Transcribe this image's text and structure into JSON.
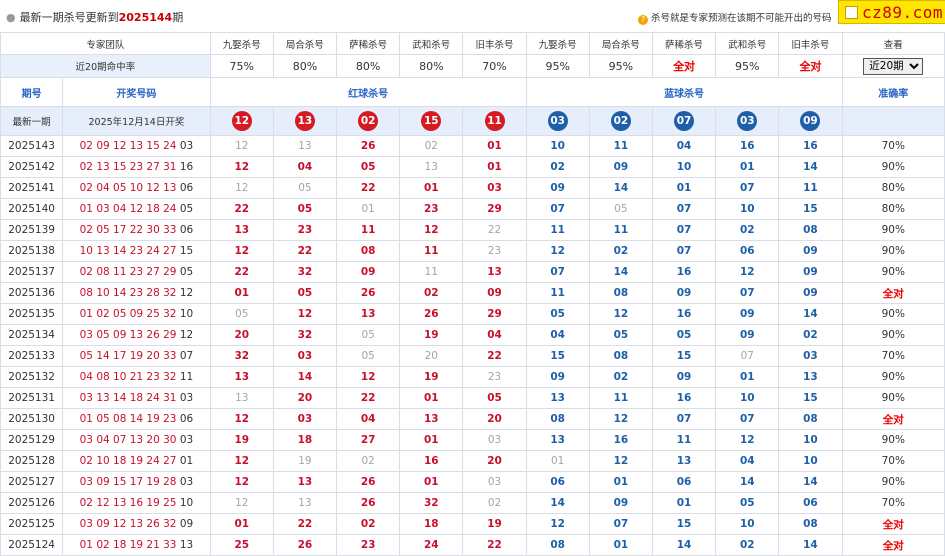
{
  "top": {
    "notice_prefix": "最新一期杀号更新到",
    "notice_period": "2025144",
    "notice_suffix": "期",
    "tip_icon": "?",
    "tip": "杀号就是专家预测在该期不可能开出的号码",
    "logo": "cz89.com"
  },
  "teams": [
    "专家团队",
    "九娶杀号",
    "局合杀号",
    "萨稀杀号",
    "武和杀号",
    "旧丰杀号",
    "九娶杀号",
    "局合杀号",
    "萨稀杀号",
    "武和杀号",
    "旧丰杀号",
    "查看"
  ],
  "rates_label": "近20期命中率",
  "rates": [
    "75%",
    "80%",
    "80%",
    "80%",
    "70%",
    "95%",
    "95%",
    "全对",
    "95%",
    "全对"
  ],
  "select": {
    "value": "近20期",
    "options": [
      "近20期"
    ]
  },
  "headers": {
    "period": "期号",
    "draw": "开奖号码",
    "red": "红球杀号",
    "blue": "蓝球杀号",
    "acc": "准确率"
  },
  "latest": {
    "label": "最新一期",
    "draw": "2025年12月14日开奖",
    "red": [
      "12",
      "13",
      "02",
      "15",
      "11"
    ],
    "blue": [
      "03",
      "02",
      "07",
      "03",
      "09"
    ]
  },
  "rows": [
    {
      "period": "2025143",
      "reds": "02 09 12 13 15 24",
      "blue": "03",
      "red": [
        [
          "12",
          0
        ],
        [
          "13",
          0
        ],
        [
          "26",
          1
        ],
        [
          "02",
          0
        ],
        [
          "01",
          1
        ]
      ],
      "bluek": [
        [
          "10",
          1
        ],
        [
          "11",
          1
        ],
        [
          "04",
          1
        ],
        [
          "16",
          1
        ],
        [
          "16",
          1
        ]
      ],
      "acc": "70%"
    },
    {
      "period": "2025142",
      "reds": "02 13 15 23 27 31",
      "blue": "16",
      "red": [
        [
          "12",
          1
        ],
        [
          "04",
          1
        ],
        [
          "05",
          1
        ],
        [
          "13",
          0
        ],
        [
          "01",
          1
        ]
      ],
      "bluek": [
        [
          "02",
          1
        ],
        [
          "09",
          1
        ],
        [
          "10",
          1
        ],
        [
          "01",
          1
        ],
        [
          "14",
          1
        ]
      ],
      "acc": "90%"
    },
    {
      "period": "2025141",
      "reds": "02 04 05 10 12 13",
      "blue": "06",
      "red": [
        [
          "12",
          0
        ],
        [
          "05",
          0
        ],
        [
          "22",
          1
        ],
        [
          "01",
          1
        ],
        [
          "03",
          1
        ]
      ],
      "bluek": [
        [
          "09",
          1
        ],
        [
          "14",
          1
        ],
        [
          "01",
          1
        ],
        [
          "07",
          1
        ],
        [
          "11",
          1
        ]
      ],
      "acc": "80%"
    },
    {
      "period": "2025140",
      "reds": "01 03 04 12 18 24",
      "blue": "05",
      "red": [
        [
          "22",
          1
        ],
        [
          "05",
          1
        ],
        [
          "01",
          0
        ],
        [
          "23",
          1
        ],
        [
          "29",
          1
        ]
      ],
      "bluek": [
        [
          "07",
          1
        ],
        [
          "05",
          0
        ],
        [
          "07",
          1
        ],
        [
          "10",
          1
        ],
        [
          "15",
          1
        ]
      ],
      "acc": "80%"
    },
    {
      "period": "2025139",
      "reds": "02 05 17 22 30 33",
      "blue": "06",
      "red": [
        [
          "13",
          1
        ],
        [
          "23",
          1
        ],
        [
          "11",
          1
        ],
        [
          "12",
          1
        ],
        [
          "22",
          0
        ]
      ],
      "bluek": [
        [
          "11",
          1
        ],
        [
          "11",
          1
        ],
        [
          "07",
          1
        ],
        [
          "02",
          1
        ],
        [
          "08",
          1
        ]
      ],
      "acc": "90%"
    },
    {
      "period": "2025138",
      "reds": "10 13 14 23 24 27",
      "blue": "15",
      "red": [
        [
          "12",
          1
        ],
        [
          "22",
          1
        ],
        [
          "08",
          1
        ],
        [
          "11",
          1
        ],
        [
          "23",
          0
        ]
      ],
      "bluek": [
        [
          "12",
          1
        ],
        [
          "02",
          1
        ],
        [
          "07",
          1
        ],
        [
          "06",
          1
        ],
        [
          "09",
          1
        ]
      ],
      "acc": "90%"
    },
    {
      "period": "2025137",
      "reds": "02 08 11 23 27 29",
      "blue": "05",
      "red": [
        [
          "22",
          1
        ],
        [
          "32",
          1
        ],
        [
          "09",
          1
        ],
        [
          "11",
          0
        ],
        [
          "13",
          1
        ]
      ],
      "bluek": [
        [
          "07",
          1
        ],
        [
          "14",
          1
        ],
        [
          "16",
          1
        ],
        [
          "12",
          1
        ],
        [
          "09",
          1
        ]
      ],
      "acc": "90%"
    },
    {
      "period": "2025136",
      "reds": "08 10 14 23 28 32",
      "blue": "12",
      "red": [
        [
          "01",
          1
        ],
        [
          "05",
          1
        ],
        [
          "26",
          1
        ],
        [
          "02",
          1
        ],
        [
          "09",
          1
        ]
      ],
      "bluek": [
        [
          "11",
          1
        ],
        [
          "08",
          1
        ],
        [
          "09",
          1
        ],
        [
          "07",
          1
        ],
        [
          "09",
          1
        ]
      ],
      "acc": "全对"
    },
    {
      "period": "2025135",
      "reds": "01 02 05 09 25 32",
      "blue": "10",
      "red": [
        [
          "05",
          0
        ],
        [
          "12",
          1
        ],
        [
          "13",
          1
        ],
        [
          "26",
          1
        ],
        [
          "29",
          1
        ]
      ],
      "bluek": [
        [
          "05",
          1
        ],
        [
          "12",
          1
        ],
        [
          "16",
          1
        ],
        [
          "09",
          1
        ],
        [
          "14",
          1
        ]
      ],
      "acc": "90%"
    },
    {
      "period": "2025134",
      "reds": "03 05 09 13 26 29",
      "blue": "12",
      "red": [
        [
          "20",
          1
        ],
        [
          "32",
          1
        ],
        [
          "05",
          0
        ],
        [
          "19",
          1
        ],
        [
          "04",
          1
        ]
      ],
      "bluek": [
        [
          "04",
          1
        ],
        [
          "05",
          1
        ],
        [
          "05",
          1
        ],
        [
          "09",
          1
        ],
        [
          "02",
          1
        ]
      ],
      "acc": "90%"
    },
    {
      "period": "2025133",
      "reds": "05 14 17 19 20 33",
      "blue": "07",
      "red": [
        [
          "32",
          1
        ],
        [
          "03",
          1
        ],
        [
          "05",
          0
        ],
        [
          "20",
          0
        ],
        [
          "22",
          1
        ]
      ],
      "bluek": [
        [
          "15",
          1
        ],
        [
          "08",
          1
        ],
        [
          "15",
          1
        ],
        [
          "07",
          0
        ],
        [
          "03",
          1
        ]
      ],
      "acc": "70%"
    },
    {
      "period": "2025132",
      "reds": "04 08 10 21 23 32",
      "blue": "11",
      "red": [
        [
          "13",
          1
        ],
        [
          "14",
          1
        ],
        [
          "12",
          1
        ],
        [
          "19",
          1
        ],
        [
          "23",
          0
        ]
      ],
      "bluek": [
        [
          "09",
          1
        ],
        [
          "02",
          1
        ],
        [
          "09",
          1
        ],
        [
          "01",
          1
        ],
        [
          "13",
          1
        ]
      ],
      "acc": "90%"
    },
    {
      "period": "2025131",
      "reds": "03 13 14 18 24 31",
      "blue": "03",
      "red": [
        [
          "13",
          0
        ],
        [
          "20",
          1
        ],
        [
          "22",
          1
        ],
        [
          "01",
          1
        ],
        [
          "05",
          1
        ]
      ],
      "bluek": [
        [
          "13",
          1
        ],
        [
          "11",
          1
        ],
        [
          "16",
          1
        ],
        [
          "10",
          1
        ],
        [
          "15",
          1
        ]
      ],
      "acc": "90%"
    },
    {
      "period": "2025130",
      "reds": "01 05 08 14 19 23",
      "blue": "06",
      "red": [
        [
          "12",
          1
        ],
        [
          "03",
          1
        ],
        [
          "04",
          1
        ],
        [
          "13",
          1
        ],
        [
          "20",
          1
        ]
      ],
      "bluek": [
        [
          "08",
          1
        ],
        [
          "12",
          1
        ],
        [
          "07",
          1
        ],
        [
          "07",
          1
        ],
        [
          "08",
          1
        ]
      ],
      "acc": "全对"
    },
    {
      "period": "2025129",
      "reds": "03 04 07 13 20 30",
      "blue": "03",
      "red": [
        [
          "19",
          1
        ],
        [
          "18",
          1
        ],
        [
          "27",
          1
        ],
        [
          "01",
          1
        ],
        [
          "03",
          0
        ]
      ],
      "bluek": [
        [
          "13",
          1
        ],
        [
          "16",
          1
        ],
        [
          "11",
          1
        ],
        [
          "12",
          1
        ],
        [
          "10",
          1
        ]
      ],
      "acc": "90%"
    },
    {
      "period": "2025128",
      "reds": "02 10 18 19 24 27",
      "blue": "01",
      "red": [
        [
          "12",
          1
        ],
        [
          "19",
          0
        ],
        [
          "02",
          0
        ],
        [
          "16",
          1
        ],
        [
          "20",
          1
        ]
      ],
      "bluek": [
        [
          "01",
          0
        ],
        [
          "12",
          1
        ],
        [
          "13",
          1
        ],
        [
          "04",
          1
        ],
        [
          "10",
          1
        ]
      ],
      "acc": "70%"
    },
    {
      "period": "2025127",
      "reds": "03 09 15 17 19 28",
      "blue": "03",
      "red": [
        [
          "12",
          1
        ],
        [
          "13",
          1
        ],
        [
          "26",
          1
        ],
        [
          "01",
          1
        ],
        [
          "03",
          0
        ]
      ],
      "bluek": [
        [
          "06",
          1
        ],
        [
          "01",
          1
        ],
        [
          "06",
          1
        ],
        [
          "14",
          1
        ],
        [
          "14",
          1
        ]
      ],
      "acc": "90%"
    },
    {
      "period": "2025126",
      "reds": "02 12 13 16 19 25",
      "blue": "10",
      "red": [
        [
          "12",
          0
        ],
        [
          "13",
          0
        ],
        [
          "26",
          1
        ],
        [
          "32",
          1
        ],
        [
          "02",
          0
        ]
      ],
      "bluek": [
        [
          "14",
          1
        ],
        [
          "09",
          1
        ],
        [
          "01",
          1
        ],
        [
          "05",
          1
        ],
        [
          "06",
          1
        ]
      ],
      "acc": "70%"
    },
    {
      "period": "2025125",
      "reds": "03 09 12 13 26 32",
      "blue": "09",
      "red": [
        [
          "01",
          1
        ],
        [
          "22",
          1
        ],
        [
          "02",
          1
        ],
        [
          "18",
          1
        ],
        [
          "19",
          1
        ]
      ],
      "bluek": [
        [
          "12",
          1
        ],
        [
          "07",
          1
        ],
        [
          "15",
          1
        ],
        [
          "10",
          1
        ],
        [
          "08",
          1
        ]
      ],
      "acc": "全对"
    },
    {
      "period": "2025124",
      "reds": "01 02 18 19 21 33",
      "blue": "13",
      "red": [
        [
          "25",
          1
        ],
        [
          "26",
          1
        ],
        [
          "23",
          1
        ],
        [
          "24",
          1
        ],
        [
          "22",
          1
        ]
      ],
      "bluek": [
        [
          "08",
          1
        ],
        [
          "01",
          1
        ],
        [
          "14",
          1
        ],
        [
          "02",
          1
        ],
        [
          "14",
          1
        ]
      ],
      "acc": "全对"
    }
  ]
}
